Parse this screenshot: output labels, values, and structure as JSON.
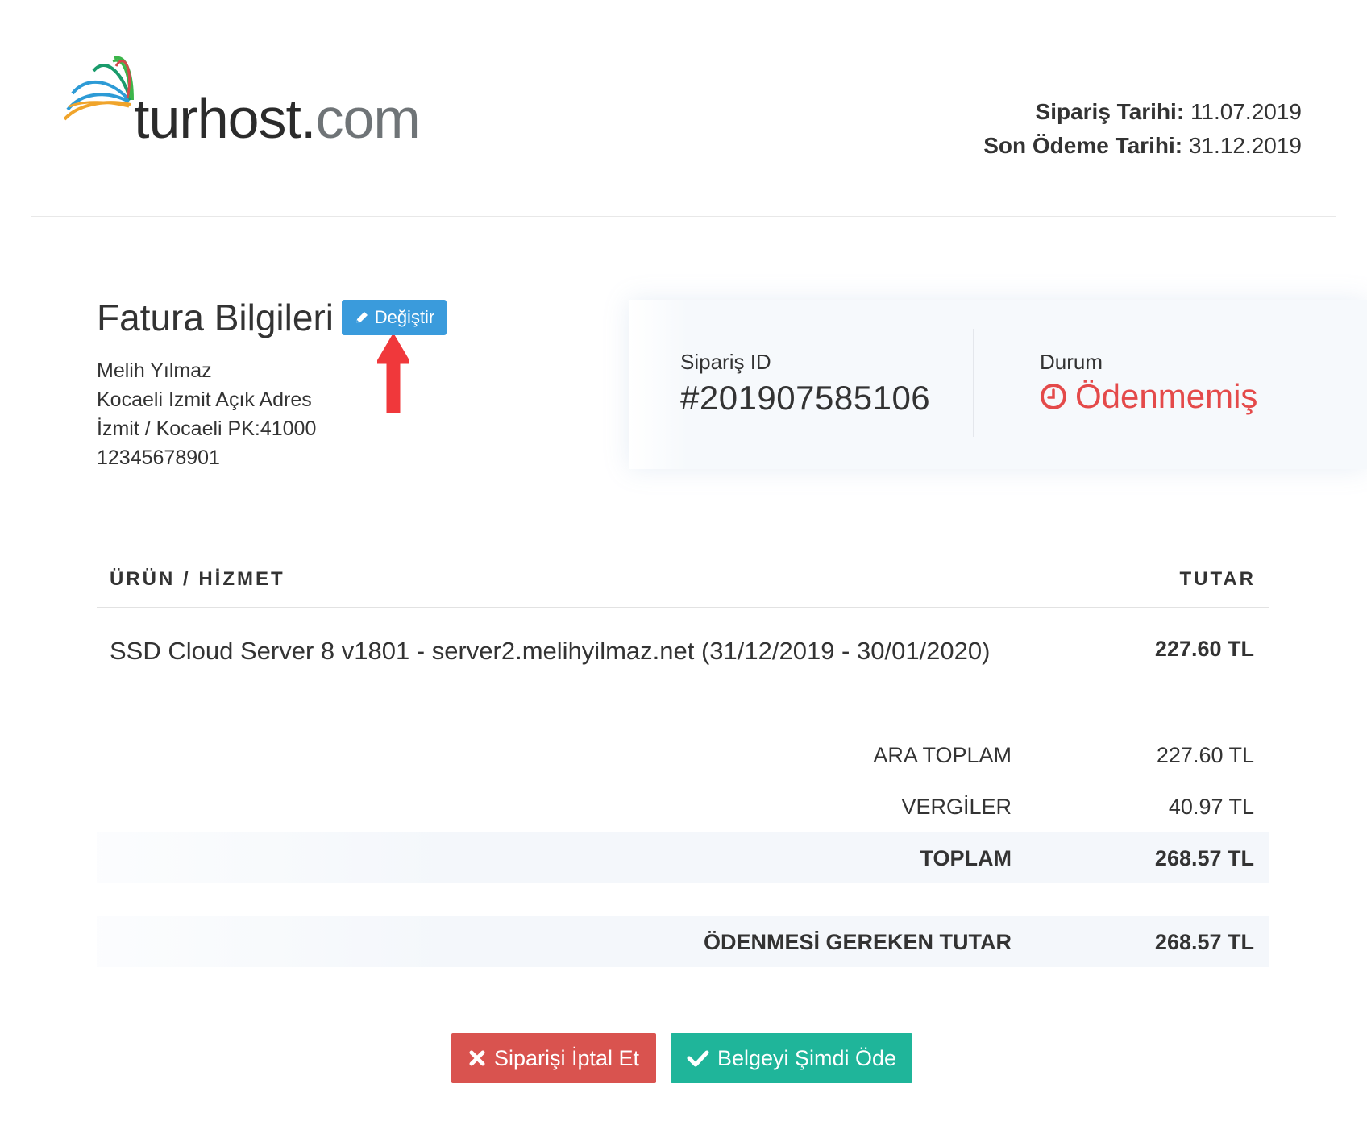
{
  "brand": {
    "name_main": "turhost",
    "name_dot": ".",
    "name_tld": "com"
  },
  "header": {
    "order_date_label": "Sipariş Tarihi:",
    "order_date_value": "11.07.2019",
    "due_date_label": "Son Ödeme Tarihi:",
    "due_date_value": "31.12.2019"
  },
  "billing": {
    "title": "Fatura Bilgileri",
    "edit_label": "Değiştir",
    "lines": [
      "Melih Yılmaz",
      "Kocaeli Izmit Açık Adres",
      "İzmit / Kocaeli PK:41000",
      "12345678901"
    ]
  },
  "order": {
    "id_label": "Sipariş ID",
    "id_value": "#201907585106",
    "status_label": "Durum",
    "status_value": "Ödenmemiş"
  },
  "table": {
    "col_product": "ÜRÜN / HİZMET",
    "col_amount": "TUTAR",
    "rows": [
      {
        "description": "SSD Cloud Server 8 v1801 - server2.melihyilmaz.net (31/12/2019 - 30/01/2020)",
        "amount": "227.60 TL"
      }
    ]
  },
  "totals": {
    "subtotal_label": "ARA TOPLAM",
    "subtotal_value": "227.60 TL",
    "tax_label": "VERGİLER",
    "tax_value": "40.97 TL",
    "total_label": "TOPLAM",
    "total_value": "268.57 TL",
    "due_label": "ÖDENMESİ GEREKEN TUTAR",
    "due_value": "268.57 TL"
  },
  "actions": {
    "cancel_label": "Siparişi İptal Et",
    "pay_label": "Belgeyi Şimdi Öde"
  },
  "colors": {
    "edit_button": "#3a9bdc",
    "status_unpaid": "#e44a4a",
    "cancel_button": "#d9534f",
    "pay_button": "#1fb59a",
    "annotation_arrow": "#f0383b"
  },
  "icons": {
    "logo": "butterfly-logo-icon",
    "edit": "pencil-icon",
    "annotation": "red-up-arrow-icon",
    "status": "clock-icon",
    "cancel": "x-icon",
    "pay": "check-icon"
  }
}
